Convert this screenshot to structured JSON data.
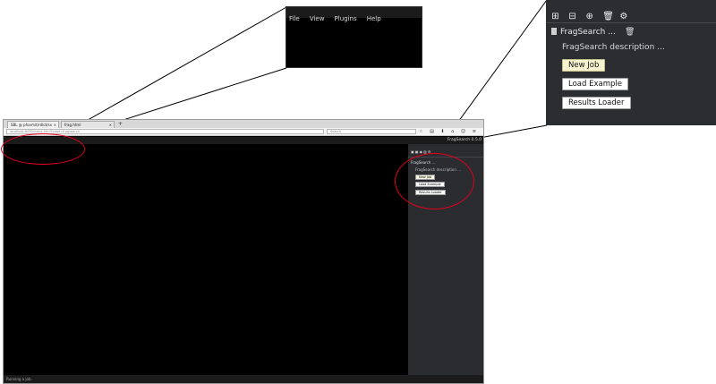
{
  "browser": {
    "tabs": [
      {
        "label": "SBL @ pharmit/rdkit/sx"
      },
      {
        "label": "frag.html"
      }
    ],
    "url": "localhost:8000/index.html?page=fragsearch",
    "search_placeholder": "Search",
    "version": "FragSearch 0.5.0"
  },
  "menu": {
    "file": "File",
    "view": "View",
    "plugins": "Plugins",
    "help": "Help"
  },
  "panel": {
    "title": "FragSearch ...",
    "description": "FragSearch description ...",
    "buttons": {
      "new_job": "New Job",
      "load_example": "Load Example",
      "results_loader": "Results Loader"
    }
  },
  "status": "Running a job.",
  "colors": {
    "highlight": "#e3001b",
    "panel_bg": "#2b2d31",
    "canvas_bg": "#000000"
  }
}
